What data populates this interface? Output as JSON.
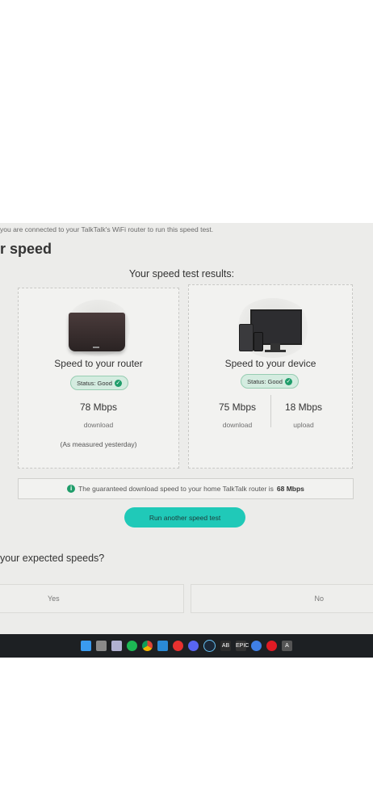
{
  "notice": "you are connected to your TalkTalk's WiFi router to run this speed test.",
  "page_heading": "r speed",
  "results_title": "Your speed test results:",
  "router_card": {
    "title": "Speed to your router",
    "status": "Status: Good",
    "download_value": "78 Mbps",
    "download_label": "download",
    "footnote": "(As measured yesterday)"
  },
  "device_card": {
    "title": "Speed to your device",
    "status": "Status: Good",
    "download_value": "75 Mbps",
    "download_label": "download",
    "upload_value": "18 Mbps",
    "upload_label": "upload"
  },
  "info": {
    "text": "The guaranteed download speed to your home TalkTalk router is",
    "value": "68 Mbps"
  },
  "cta_label": "Run another speed test",
  "question": "your expected speeds?",
  "answers": {
    "yes": "Yes",
    "no": "No"
  },
  "taskbar": {
    "icons": [
      "windows-start",
      "file-explorer",
      "snipping",
      "spotify",
      "chrome",
      "mail",
      "opera",
      "discord",
      "steam",
      "app-ab",
      "epic-games",
      "browser",
      "antivirus",
      "app-a"
    ]
  },
  "colors": {
    "accent": "#20c9b8",
    "status_green": "#1f9d6a",
    "badge_bg": "#d4ece0",
    "taskbar": "#1d2023"
  }
}
